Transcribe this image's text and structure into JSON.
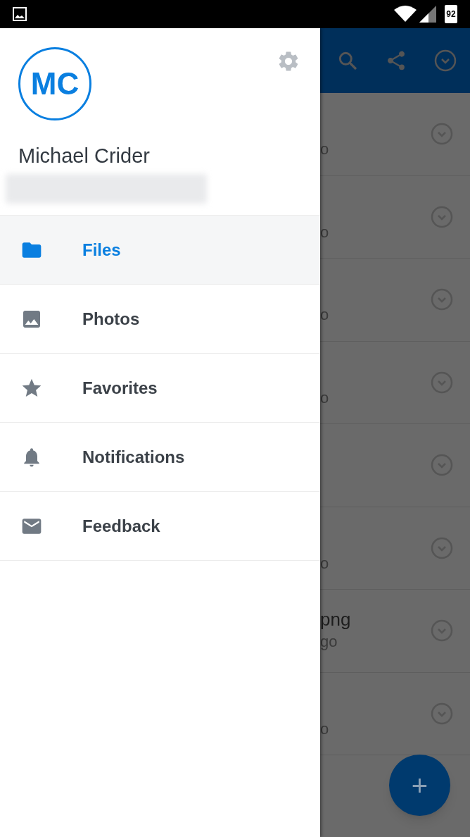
{
  "status_bar": {
    "battery": "92"
  },
  "drawer": {
    "avatar_initials": "MC",
    "name": "Michael Crider",
    "items": [
      {
        "label": "Files",
        "kind": "folder",
        "selected": true
      },
      {
        "label": "Photos",
        "kind": "image",
        "selected": false
      },
      {
        "label": "Favorites",
        "kind": "star",
        "selected": false
      },
      {
        "label": "Notifications",
        "kind": "bell",
        "selected": false
      },
      {
        "label": "Feedback",
        "kind": "mail",
        "selected": false
      }
    ]
  },
  "background_list": {
    "rows": [
      {
        "line_2": "o"
      },
      {
        "line_2": "o"
      },
      {
        "line_2": "o"
      },
      {
        "line_2": "o"
      },
      {},
      {
        "line_2": "o"
      },
      {
        "line_1": "png",
        "line_2": "go"
      },
      {
        "line_2": "o"
      }
    ],
    "fab": "+"
  }
}
